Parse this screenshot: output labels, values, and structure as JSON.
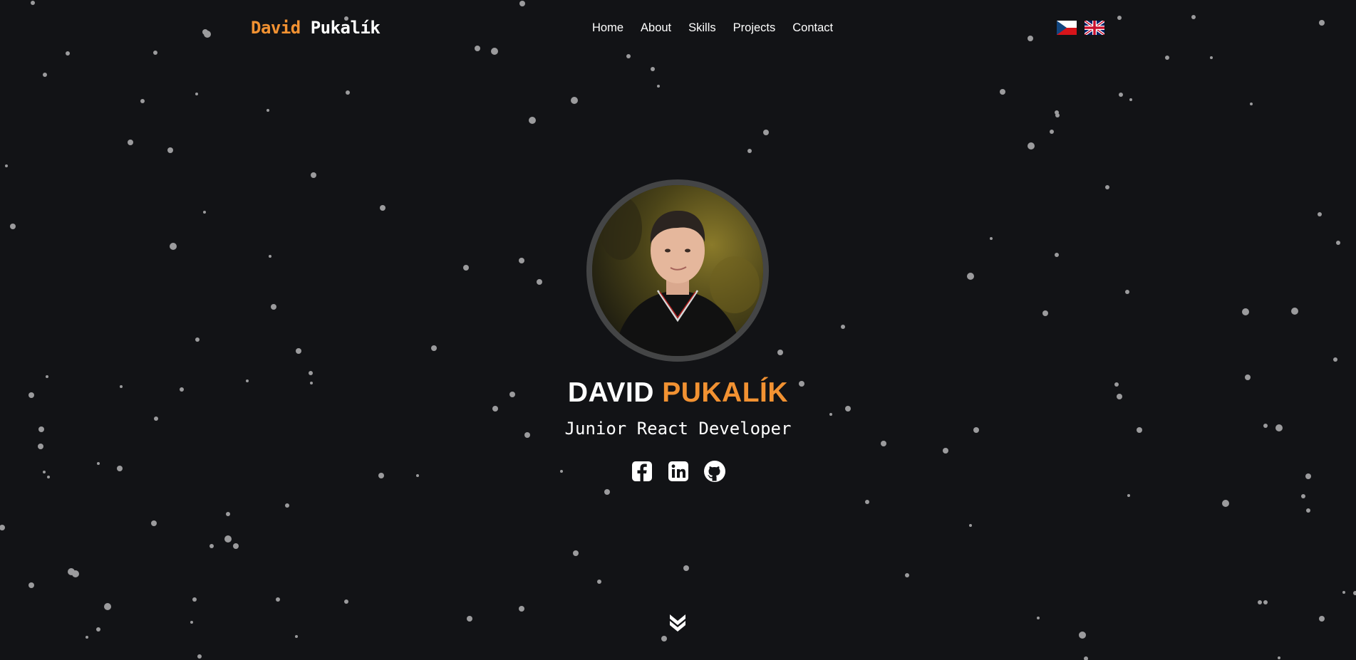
{
  "brand": {
    "first_name": "David",
    "last_name": "Pukalík"
  },
  "nav": {
    "items": [
      {
        "label": "Home"
      },
      {
        "label": "About"
      },
      {
        "label": "Skills"
      },
      {
        "label": "Projects"
      },
      {
        "label": "Contact"
      }
    ]
  },
  "languages": [
    {
      "icon": "czech-flag-icon"
    },
    {
      "icon": "uk-flag-icon"
    }
  ],
  "hero": {
    "first_name": "DAVID",
    "last_name": "PUKALÍK",
    "role": "Junior React Developer",
    "socials": [
      {
        "icon": "facebook-icon"
      },
      {
        "icon": "linkedin-icon"
      },
      {
        "icon": "github-icon"
      }
    ],
    "scroll_icon": "chevron-double-down-icon"
  },
  "colors": {
    "background": "#121316",
    "accent": "#f29232",
    "text": "#ffffff",
    "star": "#9b9b9d",
    "avatar_ring": "#444546"
  }
}
